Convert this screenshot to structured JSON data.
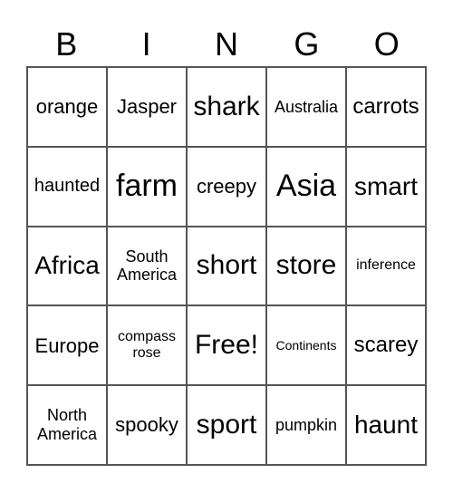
{
  "header": {
    "letters": [
      "B",
      "I",
      "N",
      "G",
      "O"
    ]
  },
  "cells": [
    [
      "orange",
      "Jasper",
      "shark",
      "Australia",
      "carrots"
    ],
    [
      "haunted",
      "farm",
      "creepy",
      "Asia",
      "smart"
    ],
    [
      "Africa",
      "South America",
      "short",
      "store",
      "inference"
    ],
    [
      "Europe",
      "compass rose",
      "Free!",
      "Continents",
      "scarey"
    ],
    [
      "North America",
      "spooky",
      "sport",
      "pumpkin",
      "haunt"
    ]
  ]
}
